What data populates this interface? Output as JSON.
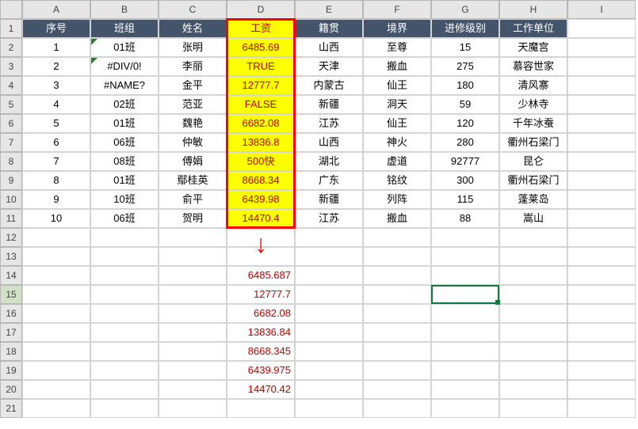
{
  "columns": [
    "A",
    "B",
    "C",
    "D",
    "E",
    "F",
    "G",
    "H",
    "I"
  ],
  "row_numbers": [
    "1",
    "2",
    "3",
    "4",
    "5",
    "6",
    "7",
    "8",
    "9",
    "10",
    "11",
    "12",
    "13",
    "14",
    "15",
    "16",
    "17",
    "18",
    "19",
    "20",
    "21"
  ],
  "headers": {
    "A": "序号",
    "B": "班组",
    "C": "姓名",
    "D": "工资",
    "E": "籍贯",
    "F": "境界",
    "G": "进修级别",
    "H": "工作单位"
  },
  "rows": [
    {
      "A": "1",
      "B": "01班",
      "C": "张明",
      "D": "6485.69",
      "E": "山西",
      "F": "至尊",
      "G": "15",
      "H": "天魔宫"
    },
    {
      "A": "2",
      "B": "#DIV/0!",
      "C": "李丽",
      "D": "TRUE",
      "E": "天津",
      "F": "搬血",
      "G": "275",
      "H": "慕容世家"
    },
    {
      "A": "3",
      "B": "#NAME?",
      "C": "金平",
      "D": "12777.7",
      "E": "内蒙古",
      "F": "仙王",
      "G": "180",
      "H": "清风寨"
    },
    {
      "A": "4",
      "B": "02班",
      "C": "范亚",
      "D": "FALSE",
      "E": "新疆",
      "F": "洞天",
      "G": "59",
      "H": "少林寺"
    },
    {
      "A": "5",
      "B": "01班",
      "C": "魏艳",
      "D": "6682.08",
      "E": "江苏",
      "F": "仙王",
      "G": "120",
      "H": "千年冰蚕"
    },
    {
      "A": "6",
      "B": "06班",
      "C": "仲敏",
      "D": "13836.8",
      "E": "山西",
      "F": "神火",
      "G": "280",
      "H": "衢州石梁门"
    },
    {
      "A": "7",
      "B": "08班",
      "C": "傅娟",
      "D": "500快",
      "E": "湖北",
      "F": "虚道",
      "G": "92777",
      "H": "昆仑"
    },
    {
      "A": "8",
      "B": "01班",
      "C": "鄢桂英",
      "D": "8668.34",
      "E": "广东",
      "F": "铭纹",
      "G": "300",
      "H": "衢州石梁门"
    },
    {
      "A": "9",
      "B": "10班",
      "C": "俞平",
      "D": "6439.98",
      "E": "新疆",
      "F": "列阵",
      "G": "115",
      "H": "蓬莱岛"
    },
    {
      "A": "10",
      "B": "06班",
      "C": "贺明",
      "D": "14470.4",
      "E": "江苏",
      "F": "搬血",
      "G": "88",
      "H": "嵩山"
    }
  ],
  "extracted": [
    "6485.687",
    "12777.7",
    "6682.08",
    "13836.84",
    "8668.345",
    "6439.975",
    "14470.42"
  ],
  "chart_data": {
    "type": "table",
    "highlighted_column": "D",
    "selected_cell": "G15",
    "extracted_values_start_row": 14
  }
}
